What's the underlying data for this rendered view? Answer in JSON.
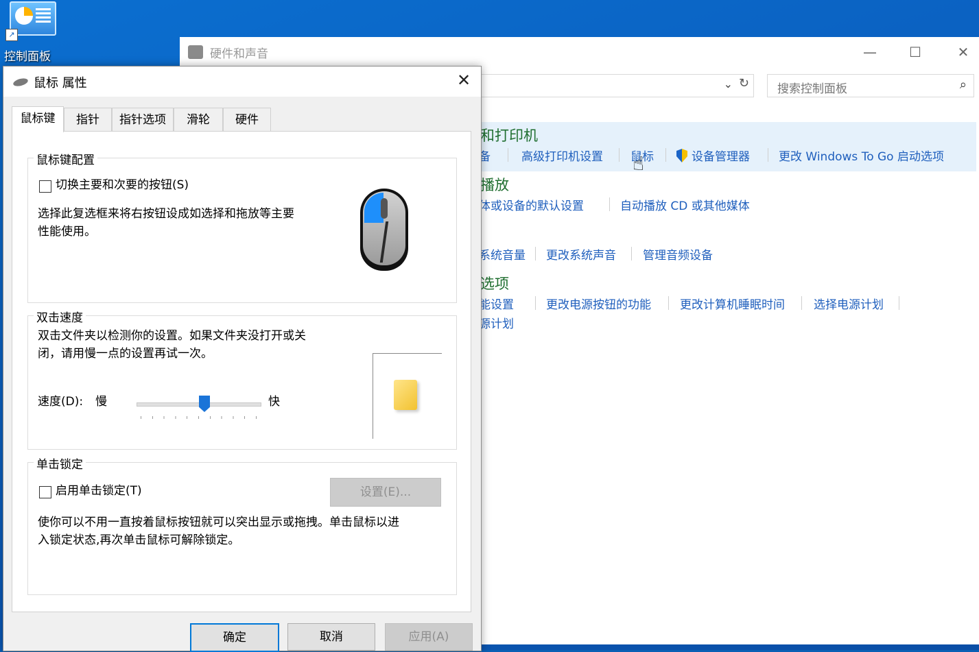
{
  "desktop": {
    "icon_label": "控制面板"
  },
  "cp": {
    "title": "硬件和声音",
    "search_placeholder": "搜索控制面板",
    "sections": [
      {
        "title": "和打印机",
        "links": [
          "备",
          "高级打印机设置",
          "鼠标",
          "设备管理器",
          "更改 Windows To Go 启动选项"
        ]
      },
      {
        "title": "播放",
        "links": [
          "体或设备的默认设置",
          "自动播放 CD 或其他媒体"
        ]
      },
      {
        "title": "",
        "links": [
          "系统音量",
          "更改系统声音",
          "管理音频设备"
        ]
      },
      {
        "title": "选项",
        "links": [
          "能设置",
          "更改电源按钮的功能",
          "更改计算机睡眠时间",
          "选择电源计划",
          "源计划"
        ]
      }
    ]
  },
  "dialog": {
    "title": "鼠标 属性",
    "tabs": [
      "鼠标键",
      "指针",
      "指针选项",
      "滑轮",
      "硬件"
    ],
    "button_config": {
      "group_label": "鼠标键配置",
      "checkbox_label": "切换主要和次要的按钮(S)",
      "description_line1": "选择此复选框来将右按钮设成如选择和拖放等主要",
      "description_line2": "性能使用。"
    },
    "double_click": {
      "group_label": "双击速度",
      "description_line1": "双击文件夹以检测你的设置。如果文件夹没打开或关",
      "description_line2": "闭，请用慢一点的设置再试一次。",
      "speed_label": "速度(D):",
      "slow_label": "慢",
      "fast_label": "快",
      "speed_fraction": 0.55
    },
    "click_lock": {
      "group_label": "单击锁定",
      "checkbox_label": "启用单击锁定(T)",
      "settings_button": "设置(E)...",
      "description_line1": "使你可以不用一直按着鼠标按钮就可以突出显示或拖拽。单击鼠标以进",
      "description_line2": "入锁定状态,再次单击鼠标可解除锁定。"
    },
    "buttons": {
      "ok": "确定",
      "cancel": "取消",
      "apply": "应用(A)"
    }
  }
}
